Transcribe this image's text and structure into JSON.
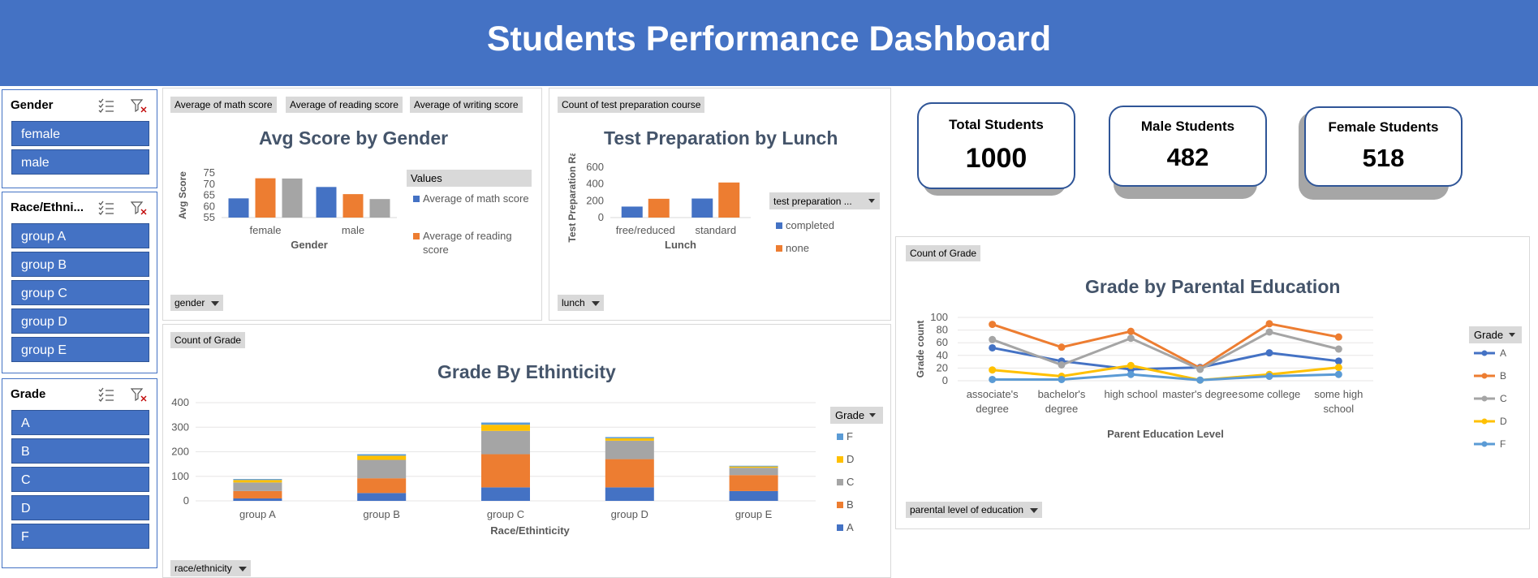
{
  "dashboard": {
    "title": "Students Performance Dashboard"
  },
  "slicers": {
    "gender": {
      "title": "Gender",
      "items": [
        "female",
        "male"
      ]
    },
    "race": {
      "title": "Race/Ethni...",
      "items": [
        "group A",
        "group B",
        "group C",
        "group D",
        "group E"
      ]
    },
    "grade": {
      "title": "Grade",
      "items": [
        "A",
        "B",
        "C",
        "D",
        "F"
      ]
    }
  },
  "kpis": {
    "total": {
      "label": "Total Students",
      "value": "1000"
    },
    "male": {
      "label": "Male Students",
      "value": "482"
    },
    "female": {
      "label": "Female Students",
      "value": "518"
    }
  },
  "field_buttons": {
    "math": "Average of math score",
    "reading": "Average of reading score",
    "writing": "Average of writing score",
    "gender": "gender",
    "test_prep_count": "Count of test preparation course",
    "lunch": "lunch",
    "count_grade_eth": "Count of Grade",
    "race": "race/ethnicity",
    "count_grade_par": "Count of Grade",
    "parental": "parental level of education"
  },
  "colors": {
    "blue": "#4472c4",
    "orange": "#ed7d31",
    "gray": "#a5a5a5",
    "yellow": "#ffc000",
    "lightblue": "#5b9bd5"
  },
  "chart_data": [
    {
      "id": "gender",
      "type": "bar",
      "title": "Avg Score by Gender",
      "xlabel": "Gender",
      "ylabel": "Avg Score",
      "ylim": [
        55,
        75
      ],
      "yticks": [
        55,
        60,
        65,
        70,
        75
      ],
      "categories": [
        "female",
        "male"
      ],
      "legend_title": "Values",
      "series": [
        {
          "name": "Average of math score",
          "color": "#4472c4",
          "values": [
            63.6,
            68.7
          ]
        },
        {
          "name": "Average of reading score",
          "color": "#ed7d31",
          "values": [
            72.6,
            65.5
          ]
        },
        {
          "name": "Average of writing score",
          "color": "#a5a5a5",
          "values": [
            72.5,
            63.3
          ]
        }
      ]
    },
    {
      "id": "lunch",
      "type": "bar",
      "title": "Test Preparation by Lunch",
      "xlabel": "Lunch",
      "ylabel": "Test Preparation Rate",
      "ylim": [
        0,
        600
      ],
      "yticks": [
        0,
        200,
        400,
        600
      ],
      "categories": [
        "free/reduced",
        "standard"
      ],
      "legend_title": "test preparation ...",
      "series": [
        {
          "name": "completed",
          "color": "#4472c4",
          "values": [
            131,
            227
          ]
        },
        {
          "name": "none",
          "color": "#ed7d31",
          "values": [
            224,
            418
          ]
        }
      ]
    },
    {
      "id": "ethnicity",
      "type": "bar",
      "stacked": true,
      "title": "Grade By Ethinticity",
      "xlabel": "Race/Ethinticity",
      "ylabel": "",
      "ylim": [
        0,
        400
      ],
      "yticks": [
        0,
        100,
        200,
        300,
        400
      ],
      "categories": [
        "group A",
        "group B",
        "group C",
        "group D",
        "group E"
      ],
      "legend_title": "Grade",
      "series": [
        {
          "name": "A",
          "color": "#4472c4",
          "values": [
            10,
            32,
            55,
            55,
            40
          ]
        },
        {
          "name": "B",
          "color": "#ed7d31",
          "values": [
            30,
            60,
            135,
            115,
            65
          ]
        },
        {
          "name": "C",
          "color": "#a5a5a5",
          "values": [
            35,
            75,
            95,
            75,
            30
          ]
        },
        {
          "name": "D",
          "color": "#ffc000",
          "values": [
            10,
            17,
            25,
            10,
            5
          ]
        },
        {
          "name": "F",
          "color": "#5b9bd5",
          "values": [
            4,
            6,
            9,
            5,
            3
          ]
        }
      ]
    },
    {
      "id": "parental",
      "type": "line",
      "title": "Grade by Parental Education",
      "xlabel": "Parent Education Level",
      "ylabel": "Grade count",
      "ylim": [
        0,
        100
      ],
      "yticks": [
        0,
        20,
        40,
        60,
        80,
        100
      ],
      "categories": [
        [
          "associate's",
          "degree"
        ],
        [
          "bachelor's",
          "degree"
        ],
        [
          "high school"
        ],
        [
          "master's degree"
        ],
        [
          "some college"
        ],
        [
          "some high",
          "school"
        ]
      ],
      "legend_title": "Grade",
      "series": [
        {
          "name": "A",
          "color": "#4472c4",
          "values": [
            52,
            31,
            18,
            21,
            44,
            31
          ]
        },
        {
          "name": "B",
          "color": "#ed7d31",
          "values": [
            89,
            53,
            78,
            20,
            90,
            69
          ]
        },
        {
          "name": "C",
          "color": "#a5a5a5",
          "values": [
            65,
            25,
            67,
            18,
            77,
            50
          ]
        },
        {
          "name": "D",
          "color": "#ffc000",
          "values": [
            17,
            7,
            24,
            1,
            10,
            21
          ]
        },
        {
          "name": "F",
          "color": "#5b9bd5",
          "values": [
            2,
            2,
            10,
            1,
            7,
            10
          ]
        }
      ]
    }
  ]
}
